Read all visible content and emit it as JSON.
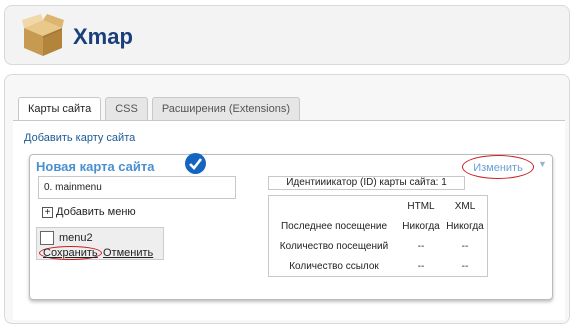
{
  "header": {
    "app_title": "Xmap",
    "icon": "cardboard-box-icon"
  },
  "tabs": [
    {
      "label": "Карты сайта",
      "active": true
    },
    {
      "label": "CSS",
      "active": false
    },
    {
      "label": "Расширения (Extensions)",
      "active": false
    }
  ],
  "add_sitemap_link": "Добавить карту сайта",
  "sitemap": {
    "title": "Новая карта сайта",
    "status_icon": "checkmark-circle-icon",
    "edit_label": "Изменить",
    "dropdown_icon": "triangle-down-icon",
    "menu_entry": "0. mainmenu",
    "add_menu_label": "Добавить меню",
    "menu_option": "menu2",
    "save_label": "Сохранить",
    "cancel_label": "Отменить",
    "id_label": "Идентииикатор (ID) карты сайта: 1"
  },
  "stats": {
    "columns": [
      "HTML",
      "XML"
    ],
    "rows": [
      {
        "label": "Последнее посещение",
        "html": "Никогда",
        "xml": "Никогда"
      },
      {
        "label": "Количество посещений",
        "html": "--",
        "xml": "--"
      },
      {
        "label": "Количество ссылок",
        "html": "--",
        "xml": "--"
      }
    ]
  },
  "colors": {
    "title_blue": "#1a3f7a",
    "card_title": "#4a90d1",
    "link_blue": "#1b5a96",
    "annotation_red": "#cc1f1f"
  }
}
